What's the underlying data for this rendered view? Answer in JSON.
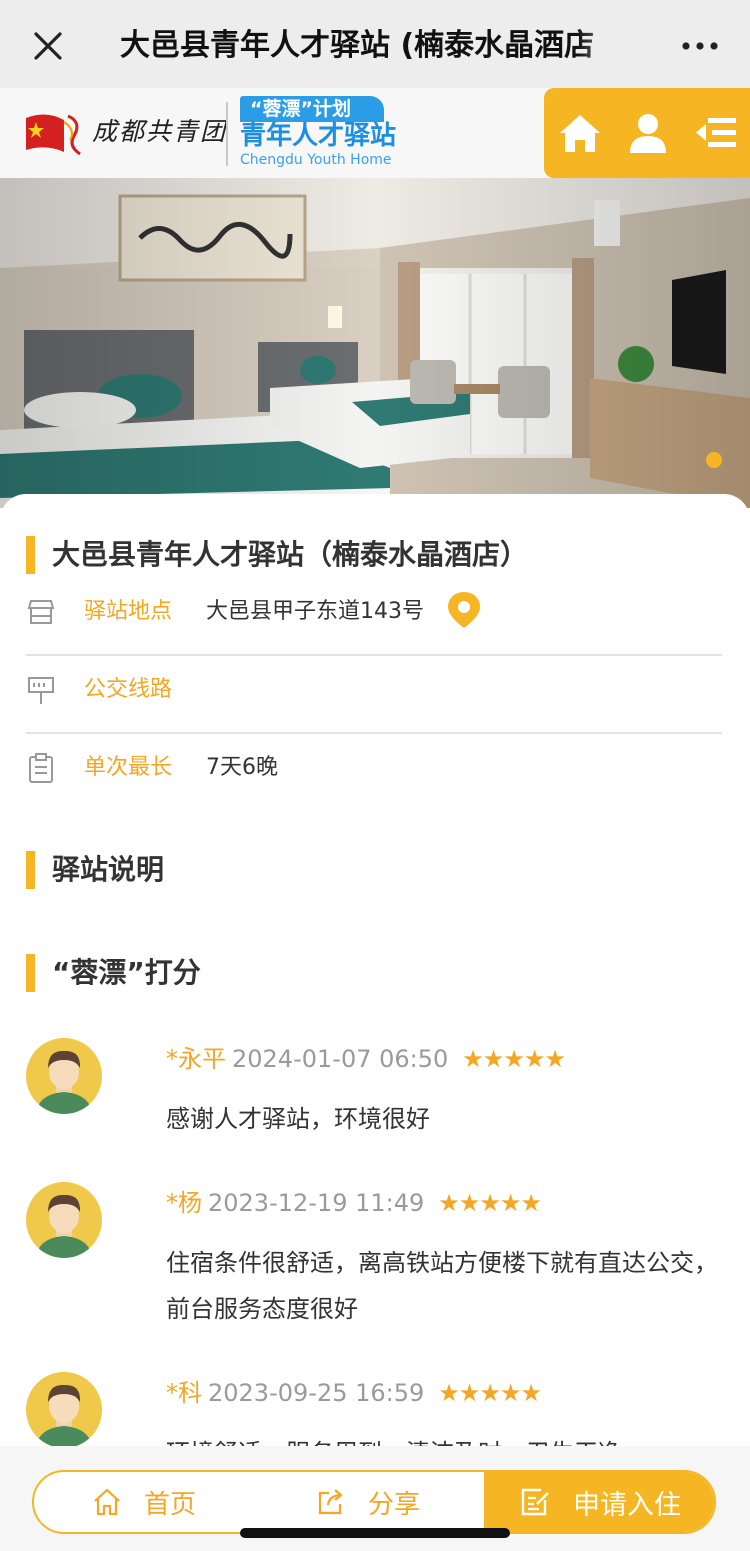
{
  "titlebar": {
    "title": "大邑县青年人才驿站 (楠泰水晶酒店",
    "close_icon": "close-icon",
    "more_icon": "more-icon"
  },
  "header": {
    "brand_text": "成都共青团",
    "plan_badge": "“蓉漂”计划",
    "station_name": "青年人才驿站",
    "station_en": "Chengdu Youth Home",
    "nav_icons": [
      "home-icon",
      "user-icon",
      "menu-icon"
    ],
    "accent": "#f6b623"
  },
  "hotel": {
    "name": "大邑县青年人才驿站（楠泰水晶酒店）",
    "location_label": "驿站地点",
    "location_value": "大邑县甲子东道143号",
    "bus_label": "公交线路",
    "bus_value": "",
    "stay_label": "单次最长",
    "stay_value": "7天6晚"
  },
  "sections": {
    "description_title": "驿站说明",
    "rating_title": "“蓉漂”打分"
  },
  "reviews": [
    {
      "name": "*永平",
      "time": "2024-01-07 06:50",
      "stars": "★★★★★",
      "rating": 5,
      "text": "感谢人才驿站，环境很好"
    },
    {
      "name": "*杨",
      "time": "2023-12-19 11:49",
      "stars": "★★★★★",
      "rating": 5,
      "text": "住宿条件很舒适，离高铁站方便楼下就有直达公交，前台服务态度很好"
    },
    {
      "name": "*科",
      "time": "2023-09-25 16:59",
      "stars": "★★★★★",
      "rating": 5,
      "text": "环境舒适，服务周到，清洁及时，卫生干净"
    }
  ],
  "bottom": {
    "home_label": "首页",
    "share_label": "分享",
    "apply_label": "申请入住"
  }
}
